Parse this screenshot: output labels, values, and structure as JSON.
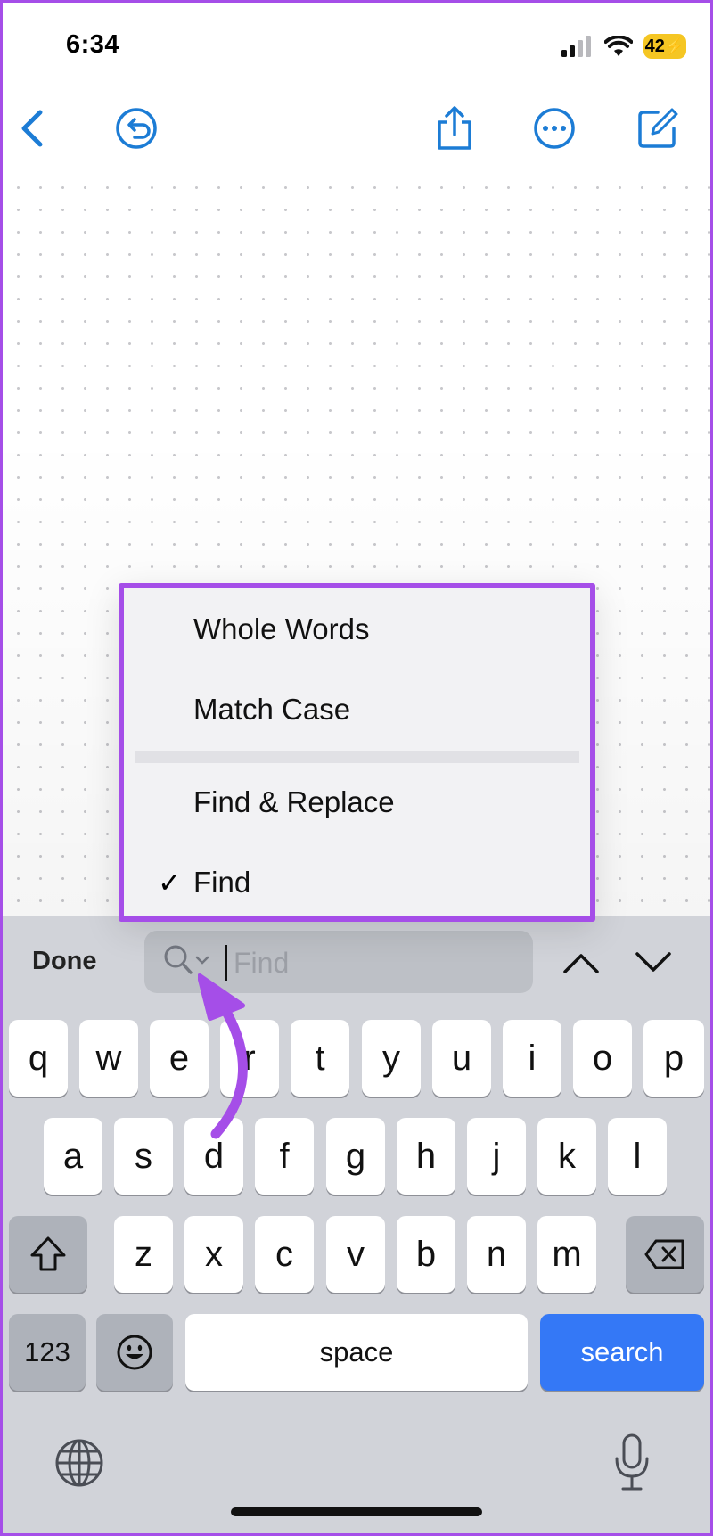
{
  "status": {
    "time": "6:34",
    "battery": "42"
  },
  "menu": {
    "items": [
      {
        "label": "Whole Words",
        "checked": false
      },
      {
        "label": "Match Case",
        "checked": false
      },
      {
        "label": "Find & Replace",
        "checked": false
      },
      {
        "label": "Find",
        "checked": true
      }
    ],
    "checkmark": "✓"
  },
  "find_bar": {
    "done_label": "Done",
    "placeholder": "Find",
    "value": ""
  },
  "keyboard": {
    "row1": [
      "q",
      "w",
      "e",
      "r",
      "t",
      "y",
      "u",
      "i",
      "o",
      "p"
    ],
    "row2": [
      "a",
      "s",
      "d",
      "f",
      "g",
      "h",
      "j",
      "k",
      "l"
    ],
    "row3": [
      "z",
      "x",
      "c",
      "v",
      "b",
      "n",
      "m"
    ],
    "numbers_label": "123",
    "space_label": "space",
    "search_label": "search"
  },
  "colors": {
    "accent": "#1c7cd5",
    "highlight": "#a54ee8",
    "search_key": "#3478f6"
  }
}
